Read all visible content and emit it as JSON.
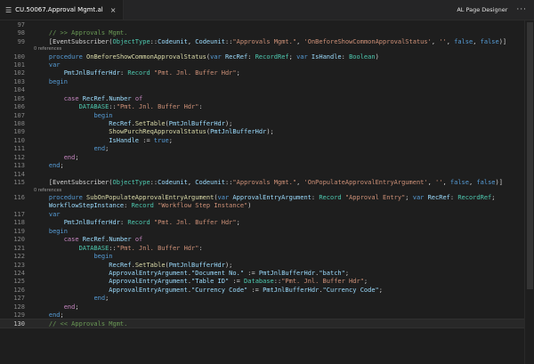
{
  "tab": {
    "title": "CU.50067.Approval Mgmt.al",
    "close": "×"
  },
  "toolbar": {
    "designer_label": "AL Page Designer",
    "more": "···"
  },
  "refs_label": "0 references",
  "lines": [
    {
      "n": "97",
      "segs": []
    },
    {
      "n": "98",
      "segs": [
        [
          "    ",
          "pl"
        ],
        [
          "// >> Approvals Mgmt.",
          "cm"
        ]
      ]
    },
    {
      "n": "99",
      "segs": [
        [
          "    ",
          "pl"
        ],
        [
          "[EventSubscriber(",
          "pl"
        ],
        [
          "ObjectType",
          "ty"
        ],
        [
          "::",
          "pl"
        ],
        [
          "Codeunit",
          "vr"
        ],
        [
          ", ",
          "pl"
        ],
        [
          "Codeunit",
          "vr"
        ],
        [
          "::",
          "pl"
        ],
        [
          "\"Approvals Mgmt.\"",
          "st"
        ],
        [
          ", ",
          "pl"
        ],
        [
          "'OnBeforeShowCommonApprovalStatus'",
          "st"
        ],
        [
          ", ",
          "pl"
        ],
        [
          "''",
          "st"
        ],
        [
          ", ",
          "pl"
        ],
        [
          "false",
          "kw"
        ],
        [
          ", ",
          "pl"
        ],
        [
          "false",
          "kw"
        ],
        [
          ")]",
          "pl"
        ]
      ],
      "ref_after": true
    },
    {
      "n": "100",
      "segs": [
        [
          "    ",
          "pl"
        ],
        [
          "procedure ",
          "kw"
        ],
        [
          "OnBeforeShowCommonApprovalStatus",
          "fn"
        ],
        [
          "(",
          "pl"
        ],
        [
          "var ",
          "kw"
        ],
        [
          "RecRef",
          "vr"
        ],
        [
          ": ",
          "pl"
        ],
        [
          "RecordRef",
          "ty"
        ],
        [
          "; ",
          "pl"
        ],
        [
          "var ",
          "kw"
        ],
        [
          "IsHandle",
          "vr"
        ],
        [
          ": ",
          "pl"
        ],
        [
          "Boolean",
          "ty"
        ],
        [
          ")",
          "pl"
        ]
      ]
    },
    {
      "n": "101",
      "segs": [
        [
          "    ",
          "pl"
        ],
        [
          "var",
          "kw"
        ]
      ]
    },
    {
      "n": "102",
      "segs": [
        [
          "        ",
          "pl"
        ],
        [
          "PmtJnlBufferHdr",
          "vr"
        ],
        [
          ": ",
          "pl"
        ],
        [
          "Record ",
          "ty"
        ],
        [
          "\"Pmt. Jnl. Buffer Hdr\"",
          "st"
        ],
        [
          ";",
          "pl"
        ]
      ]
    },
    {
      "n": "103",
      "segs": [
        [
          "    ",
          "pl"
        ],
        [
          "begin",
          "kw"
        ]
      ]
    },
    {
      "n": "104",
      "segs": []
    },
    {
      "n": "105",
      "segs": [
        [
          "        ",
          "pl"
        ],
        [
          "case ",
          "ctl"
        ],
        [
          "RecRef",
          "vr"
        ],
        [
          ".",
          "pl"
        ],
        [
          "Number ",
          "vr"
        ],
        [
          "of",
          "ctl"
        ]
      ]
    },
    {
      "n": "106",
      "segs": [
        [
          "            ",
          "pl"
        ],
        [
          "DATABASE",
          "ty"
        ],
        [
          "::",
          "pl"
        ],
        [
          "\"Pmt. Jnl. Buffer Hdr\"",
          "st"
        ],
        [
          ":",
          "pl"
        ]
      ]
    },
    {
      "n": "107",
      "segs": [
        [
          "                ",
          "pl"
        ],
        [
          "begin",
          "kw"
        ]
      ]
    },
    {
      "n": "108",
      "segs": [
        [
          "                    ",
          "pl"
        ],
        [
          "RecRef",
          "vr"
        ],
        [
          ".",
          "pl"
        ],
        [
          "SetTable",
          "fn"
        ],
        [
          "(",
          "pl"
        ],
        [
          "PmtJnlBufferHdr",
          "vr"
        ],
        [
          ");",
          "pl"
        ]
      ]
    },
    {
      "n": "109",
      "segs": [
        [
          "                    ",
          "pl"
        ],
        [
          "ShowPurchReqApprovalStatus",
          "fn"
        ],
        [
          "(",
          "pl"
        ],
        [
          "PmtJnlBufferHdr",
          "vr"
        ],
        [
          ");",
          "pl"
        ]
      ]
    },
    {
      "n": "110",
      "segs": [
        [
          "                    ",
          "pl"
        ],
        [
          "IsHandle",
          "vr"
        ],
        [
          " := ",
          "pl"
        ],
        [
          "true",
          "kw"
        ],
        [
          ";",
          "pl"
        ]
      ]
    },
    {
      "n": "111",
      "segs": [
        [
          "                ",
          "pl"
        ],
        [
          "end",
          "kw"
        ],
        [
          ";",
          "pl"
        ]
      ]
    },
    {
      "n": "112",
      "segs": [
        [
          "        ",
          "pl"
        ],
        [
          "end",
          "ctl"
        ],
        [
          ";",
          "pl"
        ]
      ]
    },
    {
      "n": "113",
      "segs": [
        [
          "    ",
          "pl"
        ],
        [
          "end",
          "kw"
        ],
        [
          ";",
          "pl"
        ]
      ]
    },
    {
      "n": "114",
      "segs": []
    },
    {
      "n": "115",
      "segs": [
        [
          "    ",
          "pl"
        ],
        [
          "[EventSubscriber(",
          "pl"
        ],
        [
          "ObjectType",
          "ty"
        ],
        [
          "::",
          "pl"
        ],
        [
          "Codeunit",
          "vr"
        ],
        [
          ", ",
          "pl"
        ],
        [
          "Codeunit",
          "vr"
        ],
        [
          "::",
          "pl"
        ],
        [
          "\"Approvals Mgmt.\"",
          "st"
        ],
        [
          ", ",
          "pl"
        ],
        [
          "'OnPopulateApprovalEntryArgument'",
          "st"
        ],
        [
          ", ",
          "pl"
        ],
        [
          "''",
          "st"
        ],
        [
          ", ",
          "pl"
        ],
        [
          "false",
          "kw"
        ],
        [
          ", ",
          "pl"
        ],
        [
          "false",
          "kw"
        ],
        [
          ")]",
          "pl"
        ]
      ],
      "ref_after": true
    },
    {
      "n": "116",
      "segs": [
        [
          "    ",
          "pl"
        ],
        [
          "procedure ",
          "kw"
        ],
        [
          "SubOnPopulateApprovalEntryArgument",
          "fn"
        ],
        [
          "(",
          "pl"
        ],
        [
          "var ",
          "kw"
        ],
        [
          "ApprovalEntryArgument",
          "vr"
        ],
        [
          ": ",
          "pl"
        ],
        [
          "Record ",
          "ty"
        ],
        [
          "\"Approval Entry\"",
          "st"
        ],
        [
          "; ",
          "pl"
        ],
        [
          "var ",
          "kw"
        ],
        [
          "RecRef",
          "vr"
        ],
        [
          ": ",
          "pl"
        ],
        [
          "RecordRef",
          "ty"
        ],
        [
          ";",
          "pl"
        ]
      ]
    },
    {
      "n": "",
      "segs": [
        [
          "    ",
          "pl"
        ],
        [
          "WorkflowStepInstance",
          "vr"
        ],
        [
          ": ",
          "pl"
        ],
        [
          "Record ",
          "ty"
        ],
        [
          "\"Workflow Step Instance\"",
          "st"
        ],
        [
          ")",
          "pl"
        ]
      ]
    },
    {
      "n": "117",
      "segs": [
        [
          "    ",
          "pl"
        ],
        [
          "var",
          "kw"
        ]
      ]
    },
    {
      "n": "118",
      "segs": [
        [
          "        ",
          "pl"
        ],
        [
          "PmtJnlBufferHdr",
          "vr"
        ],
        [
          ": ",
          "pl"
        ],
        [
          "Record ",
          "ty"
        ],
        [
          "\"Pmt. Jnl. Buffer Hdr\"",
          "st"
        ],
        [
          ";",
          "pl"
        ]
      ]
    },
    {
      "n": "119",
      "segs": [
        [
          "    ",
          "pl"
        ],
        [
          "begin",
          "kw"
        ]
      ]
    },
    {
      "n": "120",
      "segs": [
        [
          "        ",
          "pl"
        ],
        [
          "case ",
          "ctl"
        ],
        [
          "RecRef",
          "vr"
        ],
        [
          ".",
          "pl"
        ],
        [
          "Number ",
          "vr"
        ],
        [
          "of",
          "ctl"
        ]
      ]
    },
    {
      "n": "121",
      "segs": [
        [
          "            ",
          "pl"
        ],
        [
          "DATABASE",
          "ty"
        ],
        [
          "::",
          "pl"
        ],
        [
          "\"Pmt. Jnl. Buffer Hdr\"",
          "st"
        ],
        [
          ":",
          "pl"
        ]
      ]
    },
    {
      "n": "122",
      "segs": [
        [
          "                ",
          "pl"
        ],
        [
          "begin",
          "kw"
        ]
      ]
    },
    {
      "n": "123",
      "segs": [
        [
          "                    ",
          "pl"
        ],
        [
          "RecRef",
          "vr"
        ],
        [
          ".",
          "pl"
        ],
        [
          "SetTable",
          "fn"
        ],
        [
          "(",
          "pl"
        ],
        [
          "PmtJnlBufferHdr",
          "vr"
        ],
        [
          ");",
          "pl"
        ]
      ]
    },
    {
      "n": "124",
      "segs": [
        [
          "                    ",
          "pl"
        ],
        [
          "ApprovalEntryArgument",
          "vr"
        ],
        [
          ".",
          "pl"
        ],
        [
          "\"Document No.\"",
          "vr"
        ],
        [
          " := ",
          "pl"
        ],
        [
          "PmtJnlBufferHdr",
          "vr"
        ],
        [
          ".",
          "pl"
        ],
        [
          "\"batch\"",
          "vr"
        ],
        [
          ";",
          "pl"
        ]
      ]
    },
    {
      "n": "125",
      "segs": [
        [
          "                    ",
          "pl"
        ],
        [
          "ApprovalEntryArgument",
          "vr"
        ],
        [
          ".",
          "pl"
        ],
        [
          "\"Table ID\"",
          "vr"
        ],
        [
          " := ",
          "pl"
        ],
        [
          "Database",
          "ty"
        ],
        [
          "::",
          "pl"
        ],
        [
          "\"Pmt. Jnl. Buffer Hdr\"",
          "st"
        ],
        [
          ";",
          "pl"
        ]
      ]
    },
    {
      "n": "126",
      "segs": [
        [
          "                    ",
          "pl"
        ],
        [
          "ApprovalEntryArgument",
          "vr"
        ],
        [
          ".",
          "pl"
        ],
        [
          "\"Currency Code\"",
          "vr"
        ],
        [
          " := ",
          "pl"
        ],
        [
          "PmtJnlBufferHdr",
          "vr"
        ],
        [
          ".",
          "pl"
        ],
        [
          "\"Currency Code\"",
          "vr"
        ],
        [
          ";",
          "pl"
        ]
      ]
    },
    {
      "n": "127",
      "segs": [
        [
          "                ",
          "pl"
        ],
        [
          "end",
          "kw"
        ],
        [
          ";",
          "pl"
        ]
      ]
    },
    {
      "n": "128",
      "segs": [
        [
          "        ",
          "pl"
        ],
        [
          "end",
          "ctl"
        ],
        [
          ";",
          "pl"
        ]
      ]
    },
    {
      "n": "129",
      "segs": [
        [
          "    ",
          "pl"
        ],
        [
          "end",
          "kw"
        ],
        [
          ";",
          "pl"
        ]
      ]
    },
    {
      "n": "130",
      "segs": [
        [
          "    ",
          "pl"
        ],
        [
          "// << Approvals Mgmt.",
          "cm"
        ]
      ],
      "current": true
    }
  ]
}
